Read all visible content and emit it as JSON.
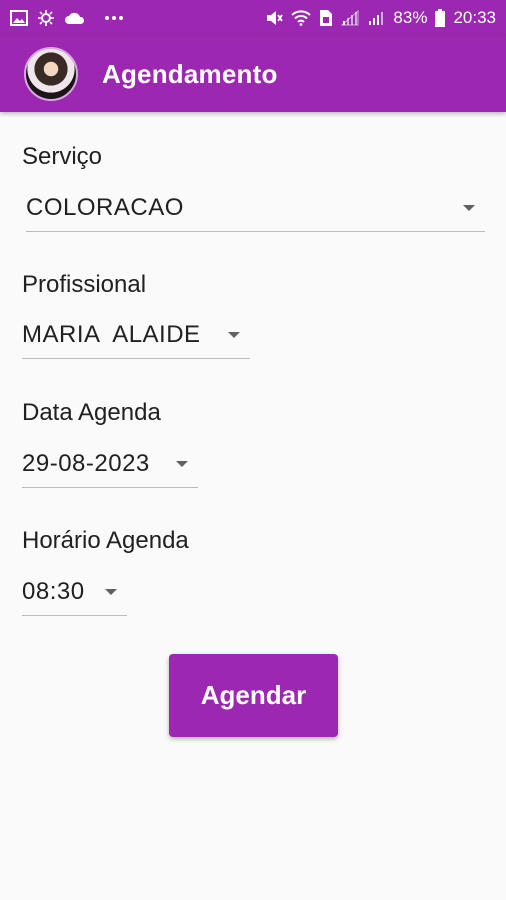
{
  "status_bar": {
    "left_icons": [
      "image-icon",
      "brightness-icon",
      "cloud-icon",
      "more-icon"
    ],
    "battery": "83%",
    "time": "20:33"
  },
  "app_bar": {
    "title": "Agendamento"
  },
  "form": {
    "servico": {
      "label": "Serviço",
      "value": "COLORACAO"
    },
    "profissional": {
      "label": "Profissional",
      "value": "MARIA  ALAIDE"
    },
    "data": {
      "label": "Data Agenda",
      "value": "29-08-2023"
    },
    "horario": {
      "label": "Horário Agenda",
      "value": "08:30"
    }
  },
  "actions": {
    "submit_label": "Agendar"
  },
  "colors": {
    "primary": "#9c27b0",
    "background": "#fafafa"
  }
}
